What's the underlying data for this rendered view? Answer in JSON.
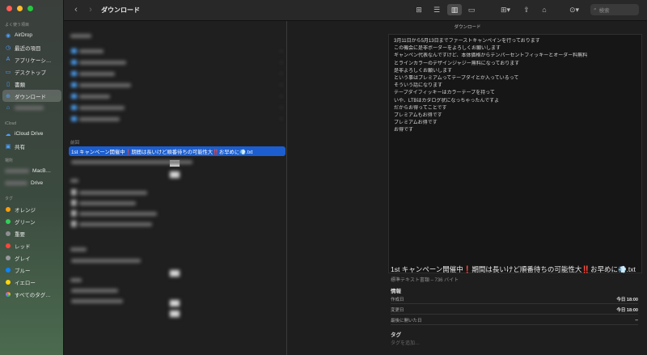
{
  "window": {
    "title": "ダウンロード"
  },
  "sidebar": {
    "favorites_header": "よく使う項目",
    "favorites": [
      {
        "label": "AirDrop",
        "icon": "airdrop-icon"
      },
      {
        "label": "最近の項目",
        "icon": "clock-icon"
      },
      {
        "label": "アプリケーシ…",
        "icon": "applications-icon"
      },
      {
        "label": "デスクトップ",
        "icon": "desktop-icon"
      },
      {
        "label": "書類",
        "icon": "document-icon"
      },
      {
        "label": "ダウンロード",
        "icon": "download-icon",
        "active": true
      },
      {
        "label": "",
        "icon": "home-icon"
      }
    ],
    "icloud_header": "iCloud",
    "icloud": [
      {
        "label": "iCloud Drive",
        "icon": "cloud-icon"
      },
      {
        "label": "共有",
        "icon": "shared-folder-icon"
      }
    ],
    "locations_header": "場所",
    "locations": [
      {
        "label": "MacB…",
        "icon": "laptop-icon"
      },
      {
        "label": "Drive",
        "icon": "drive-icon"
      }
    ],
    "tags_header": "タグ",
    "tags": [
      {
        "label": "オレンジ",
        "color": "#ff9f0a"
      },
      {
        "label": "グリーン",
        "color": "#30d158"
      },
      {
        "label": "重要",
        "color": "#8e8e93"
      },
      {
        "label": "レッド",
        "color": "#ff453a"
      },
      {
        "label": "グレイ",
        "color": "#98989d"
      },
      {
        "label": "ブルー",
        "color": "#0a84ff"
      },
      {
        "label": "イエロー",
        "color": "#ffd60a"
      },
      {
        "label": "すべてのタグ…",
        "color": "multi"
      }
    ]
  },
  "toolbar": {
    "back_icon": "chevron-left-icon",
    "forward_icon": "chevron-right-icon",
    "search_placeholder": "検索"
  },
  "filelist": {
    "group_previous": "前回",
    "selected_file": "1st キャンペーン開催中❗️期間は長いけど順番待ちの可能性大‼️お早めに💨.txt"
  },
  "preview": {
    "folder_title": "ダウンロード",
    "lines": [
      "3月11日から5月13日までファーストキャンペインを行っております",
      "この機会に是非ボーダーをよろしくお願いします",
      "ギャンペン代表なんですけど、本体価格からテンパーセントフィッキーとオーダー料無料",
      "とラインカラーのデザインジャジー無料になっております",
      "是非よろしくお願いします",
      "という事はプレミアムってテープダイとか入っているって",
      "そういう話になります",
      "テープダイフィッキーはカラーテープを持って",
      "いや、LTBはカタログ状になっちゃったんですよ",
      "だからお得ってことです",
      "プレミアムもお得です",
      "プレミアムお得です",
      "お得です"
    ]
  },
  "info": {
    "filename": "1st キャンペーン開催中❗️期間は長いけど順番待ちの可能性大‼️お早めに💨.txt",
    "kind": "標準テキスト書類 – 736 バイト",
    "info_header": "情報",
    "rows": [
      {
        "label": "作成日",
        "value": "今日 18:00"
      },
      {
        "label": "変更日",
        "value": "今日 18:00"
      },
      {
        "label": "最後に開いた日",
        "value": "--"
      }
    ],
    "tags_header": "タグ",
    "tags_placeholder": "タグを追加…"
  }
}
